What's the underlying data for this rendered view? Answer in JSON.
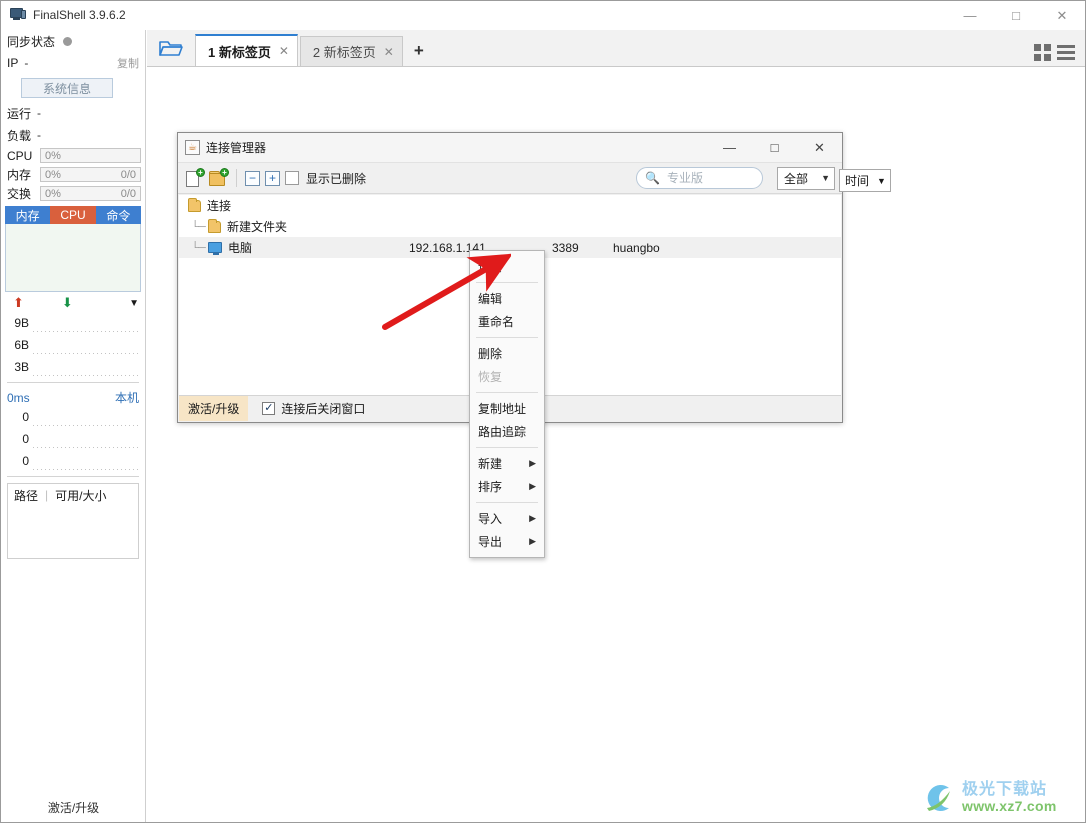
{
  "window": {
    "title": "FinalShell 3.9.6.2",
    "icon": "monitor-icon",
    "minimize": "—",
    "maximize": "□",
    "close": "✕"
  },
  "sidebar": {
    "sync_label": "同步状态",
    "ip_label": "IP",
    "ip_value": "-",
    "copy_label": "复制",
    "sysinfo_button": "系统信息",
    "uptime_label": "运行",
    "uptime_value": "-",
    "load_label": "负载",
    "load_value": "-",
    "meters": [
      {
        "name": "CPU",
        "pct": "0%",
        "frac": ""
      },
      {
        "name": "内存",
        "pct": "0%",
        "frac": "0/0"
      },
      {
        "name": "交换",
        "pct": "0%",
        "frac": "0/0"
      }
    ],
    "chart_tabs": [
      {
        "label": "内存",
        "color": "#3e7fd0"
      },
      {
        "label": "CPU",
        "color": "#d9603d"
      },
      {
        "label": "命令",
        "color": "#3e7fd0"
      }
    ],
    "net": {
      "up_icon": "arrow-up-icon",
      "down_icon": "arrow-down-icon",
      "caret_icon": "chevron-down-icon",
      "scale": [
        "9B",
        "6B",
        "3B"
      ]
    },
    "ping": {
      "value": "0ms",
      "host": "本机",
      "scale": [
        "0",
        "0",
        "0"
      ]
    },
    "disk": {
      "col_path": "路径",
      "col_size": "可用/大小"
    },
    "footer": "激活/升级"
  },
  "tabstrip": {
    "open_icon": "open-folder-icon",
    "tabs": [
      {
        "label": "1 新标签页",
        "close": "✕",
        "active": true
      },
      {
        "label": "2 新标签页",
        "close": "✕",
        "active": false
      }
    ],
    "add_label": "+",
    "grid_icon": "grid-view-icon",
    "menu_icon": "hamburger-menu-icon"
  },
  "dialog": {
    "title": "连接管理器",
    "icon": "java-app-icon",
    "minimize": "—",
    "maximize": "□",
    "close": "✕",
    "toolbar": {
      "new_connection_icon": "new-connection-icon",
      "new_folder_icon": "new-folder-icon",
      "collapse_all_icon": "collapse-all-icon",
      "collapse_all_label": "−",
      "expand_all_icon": "expand-all-icon",
      "expand_all_label": "+",
      "show_deleted_label": "显示已删除",
      "search_placeholder": "专业版",
      "search_value": "",
      "search_icon": "search-icon",
      "filter_value": "全部",
      "sort_value": "时间"
    },
    "tree": {
      "root": {
        "label": "连接",
        "icon": "folder-icon"
      },
      "rows": [
        {
          "label": "新建文件夹",
          "icon": "folder-icon",
          "ip": "",
          "port": "",
          "user": "",
          "selected": false
        },
        {
          "label": "电脑",
          "icon": "computer-icon",
          "ip": "192.168.1.141",
          "port": "3389",
          "user": "huangbo",
          "selected": true
        }
      ]
    },
    "bottom": {
      "upgrade_label": "激活/升级",
      "close_after_connect_label": "连接后关闭窗口",
      "close_after_connect_checked": true,
      "checkmark": "✓"
    }
  },
  "context_menu": {
    "items": [
      {
        "label": "连接",
        "submenu": false,
        "disabled": false
      },
      {
        "separator": true
      },
      {
        "label": "编辑",
        "submenu": false,
        "disabled": false
      },
      {
        "label": "重命名",
        "submenu": false,
        "disabled": false
      },
      {
        "separator": true
      },
      {
        "label": "删除",
        "submenu": false,
        "disabled": false
      },
      {
        "label": "恢复",
        "submenu": false,
        "disabled": true
      },
      {
        "separator": true
      },
      {
        "label": "复制地址",
        "submenu": false,
        "disabled": false
      },
      {
        "label": "路由追踪",
        "submenu": false,
        "disabled": false
      },
      {
        "separator": true
      },
      {
        "label": "新建",
        "submenu": true,
        "disabled": false
      },
      {
        "label": "排序",
        "submenu": true,
        "disabled": false
      },
      {
        "separator": true
      },
      {
        "label": "导入",
        "submenu": true,
        "disabled": false
      },
      {
        "label": "导出",
        "submenu": true,
        "disabled": false
      }
    ],
    "submenu_glyph": "▶"
  },
  "annotation": {
    "arrow_color": "#e01b1b",
    "arrow_name": "red-pointer-arrow"
  },
  "watermark": {
    "cn": "极光下载站",
    "en": "www.xz7.com",
    "logo": "aurora-logo-icon"
  }
}
